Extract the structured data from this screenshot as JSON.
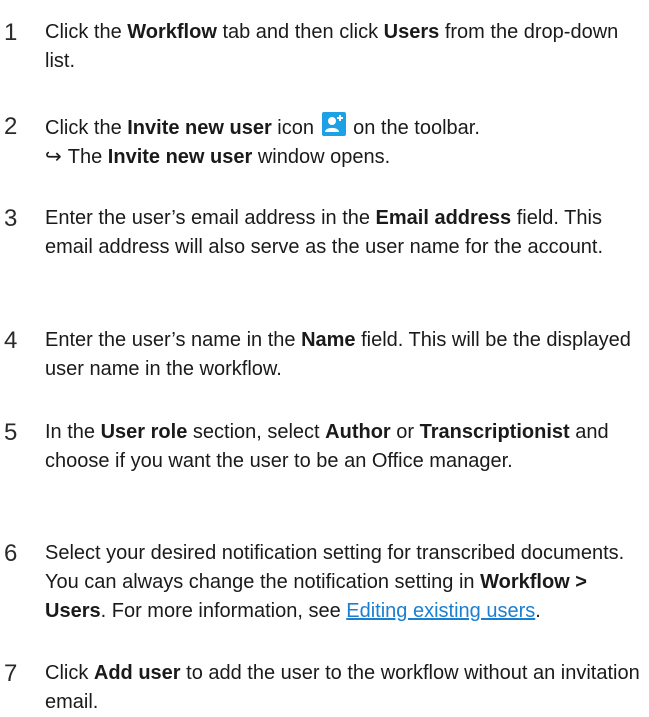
{
  "steps": [
    {
      "number": "1",
      "segments": [
        "Click the ",
        "Workflow",
        " tab and then click ",
        "Users",
        " from the drop-down list."
      ]
    },
    {
      "number": "2",
      "segments": [
        "Click the ",
        "Invite new user",
        " icon ",
        " on the toolbar."
      ],
      "icon": "invite-new-user-icon",
      "result": {
        "arrow": "↪",
        "segments": [
          "The ",
          "Invite new user",
          " window opens."
        ]
      }
    },
    {
      "number": "3",
      "segments": [
        "Enter the user’s email address in the ",
        "Email address",
        " field. This email address will also serve as the user name for the account."
      ]
    },
    {
      "number": "4",
      "segments": [
        "Enter the user’s name in the ",
        "Name",
        " field. This will be the displayed user name in the workflow."
      ]
    },
    {
      "number": "5",
      "segments": [
        "In the ",
        "User role",
        " section, select ",
        "Author",
        " or ",
        "Transcriptionist",
        " and choose if you want the user to be an Office manager."
      ]
    },
    {
      "number": "6",
      "segments": [
        "Select your desired notification setting for transcribed documents. You can always change the notification setting in ",
        "Workflow > Users",
        ". For more information, see ",
        "Editing existing users",
        "."
      ]
    },
    {
      "number": "7",
      "segments": [
        "Click ",
        "Add user",
        " to add the user to the workflow without an invitation email."
      ]
    }
  ],
  "colors": {
    "link": "#1a7fd1",
    "icon_background": "#1ca0e6",
    "text": "#1a1a1a"
  }
}
